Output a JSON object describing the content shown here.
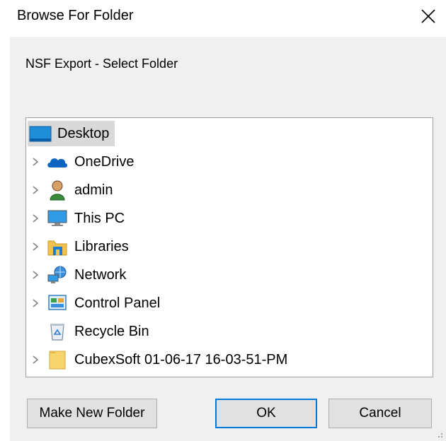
{
  "window": {
    "title": "Browse For Folder"
  },
  "dialog": {
    "description": "NSF Export - Select Folder"
  },
  "tree": {
    "root": {
      "label": "Desktop",
      "icon": "desktop-folder-icon",
      "selected": true
    },
    "items": [
      {
        "label": "OneDrive",
        "icon": "onedrive-cloud-icon",
        "expandable": true
      },
      {
        "label": "admin",
        "icon": "user-icon",
        "expandable": true
      },
      {
        "label": "This PC",
        "icon": "monitor-icon",
        "expandable": true
      },
      {
        "label": "Libraries",
        "icon": "libraries-icon",
        "expandable": true
      },
      {
        "label": "Network",
        "icon": "network-icon",
        "expandable": true
      },
      {
        "label": "Control Panel",
        "icon": "control-panel-icon",
        "expandable": true
      },
      {
        "label": "Recycle Bin",
        "icon": "recycle-bin-icon",
        "expandable": false
      },
      {
        "label": "CubexSoft 01-06-17 16-03-51-PM",
        "icon": "folder-icon",
        "expandable": true
      }
    ]
  },
  "buttons": {
    "make_new_folder": "Make New Folder",
    "ok": "OK",
    "cancel": "Cancel"
  },
  "colors": {
    "accent": "#0078d7",
    "dialog_background": "#f0f0f0",
    "selection_background": "#d9d9d9"
  }
}
